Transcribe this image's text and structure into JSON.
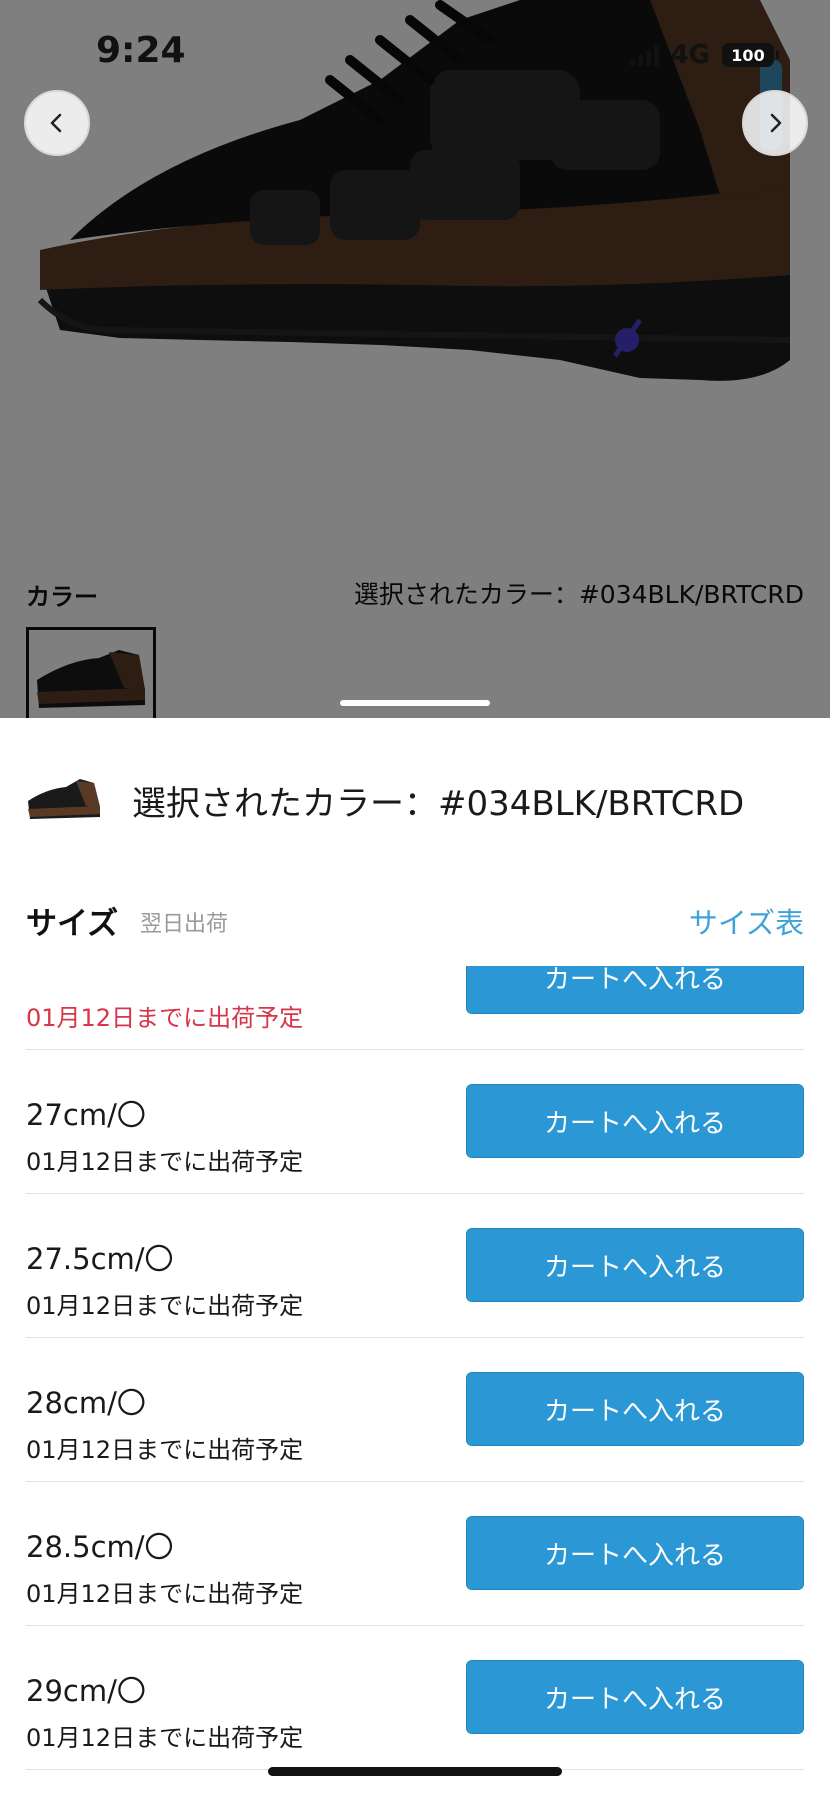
{
  "status_bar": {
    "time": "9:24",
    "network": "4G",
    "battery": "100"
  },
  "product_gallery": {
    "prev_icon": "chevron-left-icon",
    "next_icon": "chevron-right-icon"
  },
  "color_section": {
    "label": "カラー",
    "selected_text": "選択されたカラー：#034BLK/BRTCRD"
  },
  "sheet": {
    "selected_color_text": "選択されたカラー：#034BLK/BRTCRD",
    "size_title": "サイズ",
    "size_subtitle": "翌日出荷",
    "size_chart_link": "サイズ表"
  },
  "size_rows": [
    {
      "size": "",
      "shipping": "01月12日までに出荷予定",
      "urgent": true,
      "button": "カートへ入れる"
    },
    {
      "size": "27cm/〇",
      "shipping": "01月12日までに出荷予定",
      "urgent": false,
      "button": "カートへ入れる"
    },
    {
      "size": "27.5cm/〇",
      "shipping": "01月12日までに出荷予定",
      "urgent": false,
      "button": "カートへ入れる"
    },
    {
      "size": "28cm/〇",
      "shipping": "01月12日までに出荷予定",
      "urgent": false,
      "button": "カートへ入れる"
    },
    {
      "size": "28.5cm/〇",
      "shipping": "01月12日までに出荷予定",
      "urgent": false,
      "button": "カートへ入れる"
    },
    {
      "size": "29cm/〇",
      "shipping": "01月12日までに出荷予定",
      "urgent": false,
      "button": "カートへ入れる"
    }
  ],
  "colors": {
    "accent": "#2b97d4",
    "urgent": "#d8344a",
    "link": "#3ea3d9"
  }
}
